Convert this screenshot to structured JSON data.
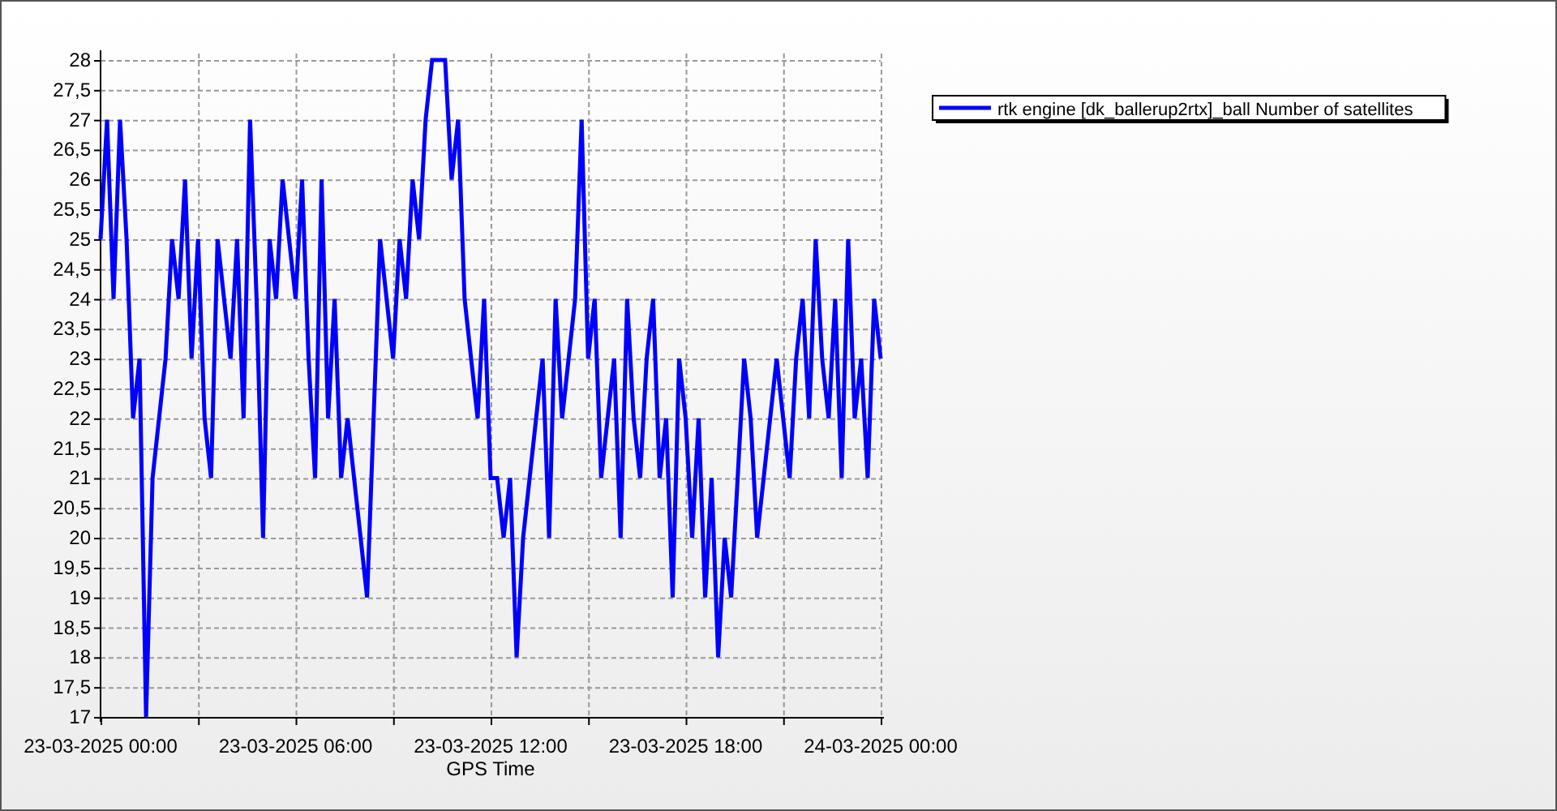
{
  "chart": {
    "chart_data": {
      "type": "line",
      "xlabel": "GPS Time",
      "categories": [
        "23-03-2025 00:00",
        null,
        null,
        null,
        null,
        null,
        null,
        null,
        null,
        null,
        null,
        null,
        null,
        null,
        null,
        null,
        null,
        null,
        null,
        null,
        null,
        null,
        null,
        null,
        null,
        null,
        null,
        null,
        null,
        null,
        "23-03-2025 06:00",
        null,
        null,
        null,
        null,
        null,
        null,
        null,
        null,
        null,
        null,
        null,
        null,
        null,
        null,
        null,
        null,
        null,
        null,
        null,
        null,
        null,
        null,
        null,
        null,
        null,
        null,
        null,
        null,
        null,
        "23-03-2025 12:00",
        null,
        null,
        null,
        null,
        null,
        null,
        null,
        null,
        null,
        null,
        null,
        null,
        null,
        null,
        null,
        null,
        null,
        null,
        null,
        null,
        null,
        null,
        null,
        null,
        null,
        null,
        null,
        null,
        null,
        "23-03-2025 18:00",
        null,
        null,
        null,
        null,
        null,
        null,
        null,
        null,
        null,
        null,
        null,
        null,
        null,
        null,
        null,
        null,
        null,
        null,
        null,
        null,
        null,
        null,
        null,
        null,
        null,
        null,
        null,
        null,
        null,
        "24-03-2025 00:00"
      ],
      "series": [
        {
          "name": "rtk engine [dk_ballerup2rtx]_ball Number of satellites",
          "color": "#0000ff",
          "values": [
            25,
            27,
            24,
            27,
            25,
            22,
            23,
            17,
            21,
            22,
            23,
            25,
            24,
            26,
            23,
            25,
            22,
            21,
            25,
            24,
            23,
            25,
            22,
            27,
            24,
            20,
            25,
            24,
            26,
            25,
            24,
            26,
            23,
            21,
            26,
            22,
            24,
            21,
            22,
            21,
            20,
            19,
            22,
            25,
            24,
            23,
            25,
            24,
            26,
            25,
            27,
            28,
            28,
            28,
            26,
            27,
            24,
            23,
            22,
            24,
            21,
            21,
            20,
            21,
            18,
            20,
            21,
            22,
            23,
            20,
            24,
            22,
            23,
            24,
            27,
            23,
            24,
            21,
            22,
            23,
            20,
            24,
            22,
            21,
            23,
            24,
            21,
            22,
            19,
            23,
            22,
            20,
            22,
            19,
            21,
            18,
            20,
            19,
            21,
            23,
            22,
            20,
            21,
            22,
            23,
            22,
            21,
            23,
            24,
            22,
            25,
            23,
            22,
            24,
            21,
            25,
            22,
            23,
            21,
            24,
            23
          ]
        }
      ],
      "ylim": [
        17,
        28
      ],
      "grid": true,
      "yticks": [
        {
          "value": 17,
          "label": "17"
        },
        {
          "value": 17.5,
          "label": "17,5"
        },
        {
          "value": 18,
          "label": "18"
        },
        {
          "value": 18.5,
          "label": "18,5"
        },
        {
          "value": 19,
          "label": "19"
        },
        {
          "value": 19.5,
          "label": "19,5"
        },
        {
          "value": 20,
          "label": "20"
        },
        {
          "value": 20.5,
          "label": "20,5"
        },
        {
          "value": 21,
          "label": "21"
        },
        {
          "value": 21.5,
          "label": "21,5"
        },
        {
          "value": 22,
          "label": "22"
        },
        {
          "value": 22.5,
          "label": "22,5"
        },
        {
          "value": 23,
          "label": "23"
        },
        {
          "value": 23.5,
          "label": "23,5"
        },
        {
          "value": 24,
          "label": "24"
        },
        {
          "value": 24.5,
          "label": "24,5"
        },
        {
          "value": 25,
          "label": "25"
        },
        {
          "value": 25.5,
          "label": "25,5"
        },
        {
          "value": 26,
          "label": "26"
        },
        {
          "value": 26.5,
          "label": "26,5"
        },
        {
          "value": 27,
          "label": "27"
        },
        {
          "value": 27.5,
          "label": "27,5"
        },
        {
          "value": 28,
          "label": "28"
        }
      ]
    }
  }
}
